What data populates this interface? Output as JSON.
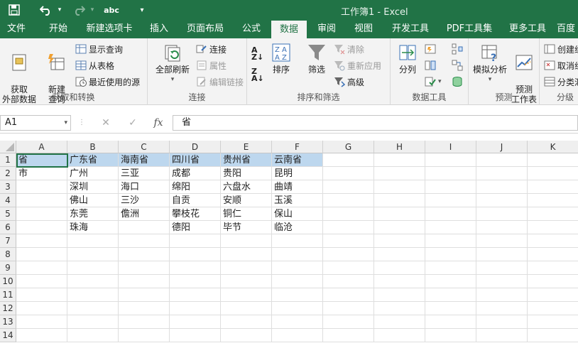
{
  "window": {
    "title": "工作簿1 - Excel",
    "accent": "#217346"
  },
  "quick_access": {
    "save_icon": "save-icon",
    "undo_icon": "undo-icon",
    "redo_icon": "redo-icon",
    "spell_label": "abc",
    "customize_icon": "chevron-down-icon"
  },
  "tabs": [
    {
      "label": "文件"
    },
    {
      "label": "开始"
    },
    {
      "label": "新建选项卡"
    },
    {
      "label": "插入"
    },
    {
      "label": "页面布局"
    },
    {
      "label": "公式"
    },
    {
      "label": "数据"
    },
    {
      "label": "审阅"
    },
    {
      "label": "视图"
    },
    {
      "label": "开发工具"
    },
    {
      "label": "PDF工具集"
    },
    {
      "label": "更多工具"
    },
    {
      "label": "百度"
    }
  ],
  "ribbon": {
    "get_transform": {
      "label": "获取和转换",
      "get_external": "获取\n外部数据",
      "new_query": "新建\n查询",
      "show_query": "显示查询",
      "from_table": "从表格",
      "recent_sources": "最近使用的源"
    },
    "connections": {
      "label": "连接",
      "refresh_all": "全部刷新",
      "connections": "连接",
      "properties": "属性",
      "edit_links": "编辑链接"
    },
    "sort_filter": {
      "label": "排序和筛选",
      "sort": "排序",
      "filter": "筛选",
      "clear": "清除",
      "reapply": "重新应用",
      "advanced": "高级"
    },
    "data_tools": {
      "label": "数据工具",
      "split_columns": "分列"
    },
    "forecast": {
      "label": "预测",
      "what_if": "模拟分析",
      "forecast_sheet": "预测\n工作表"
    },
    "outline": {
      "label": "分级",
      "group": "创建组",
      "ungroup": "取消组",
      "subtotal": "分类汇"
    }
  },
  "formula_bar": {
    "name_box": "A1",
    "cancel": "✕",
    "enter": "✓",
    "fx": "fx",
    "content": "省"
  },
  "sheet": {
    "columns": [
      "A",
      "B",
      "C",
      "D",
      "E",
      "F",
      "G",
      "H",
      "I",
      "J",
      "K"
    ],
    "rows": [
      "1",
      "2",
      "3",
      "4",
      "5",
      "6",
      "7",
      "8",
      "9",
      "10",
      "11",
      "12",
      "13",
      "14"
    ],
    "cells": [
      [
        "省",
        "广东省",
        "海南省",
        "四川省",
        "贵州省",
        "云南省"
      ],
      [
        "市",
        "广州",
        "三亚",
        "成都",
        "贵阳",
        "昆明"
      ],
      [
        "",
        "深圳",
        "海口",
        "绵阳",
        "六盘水",
        "曲靖"
      ],
      [
        "",
        "佛山",
        "三沙",
        "自贡",
        "安顺",
        "玉溪"
      ],
      [
        "",
        "东莞",
        "儋洲",
        "攀枝花",
        "铜仁",
        "保山"
      ],
      [
        "",
        "珠海",
        "",
        "德阳",
        "毕节",
        "临沧"
      ]
    ],
    "highlight_color": "#bdd7ee"
  }
}
